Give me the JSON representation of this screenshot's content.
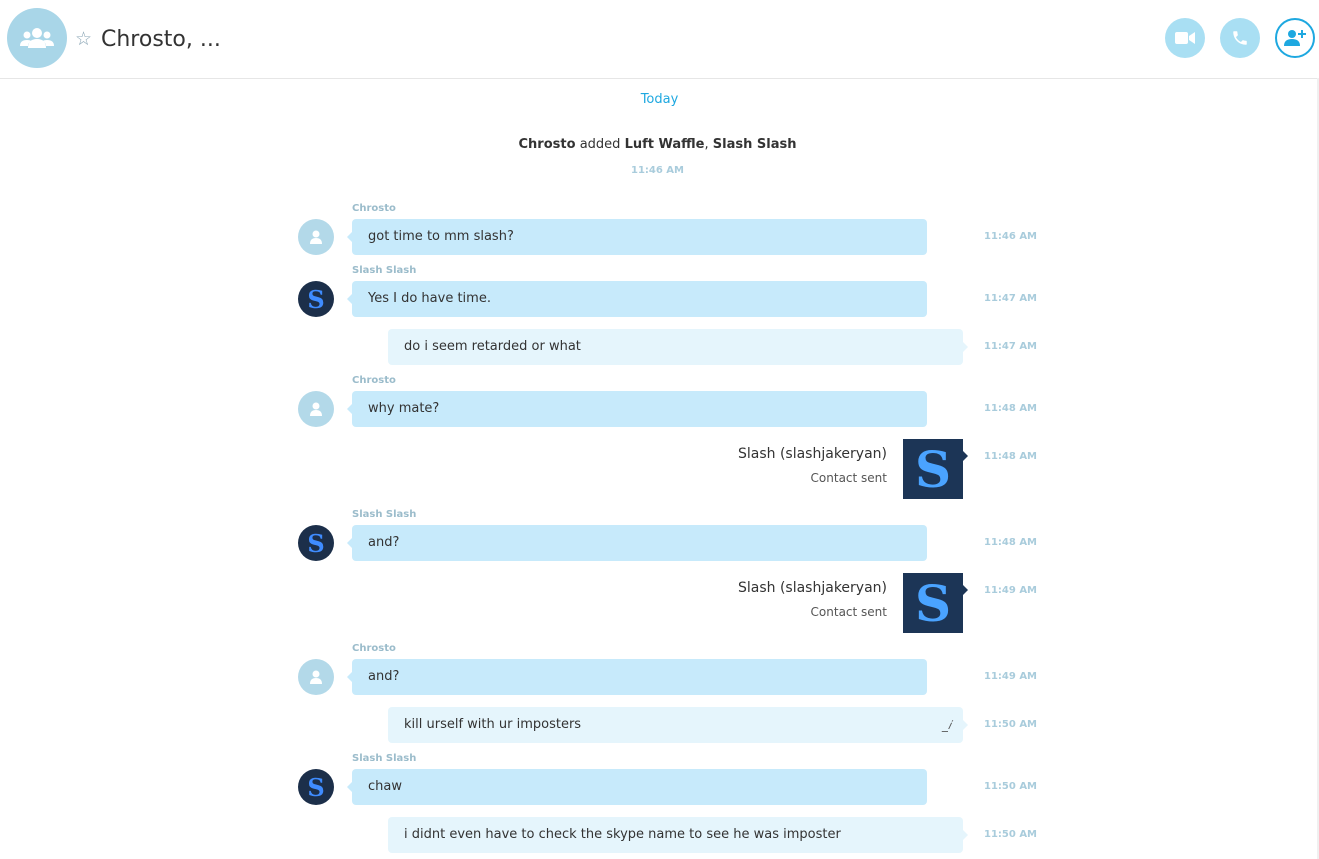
{
  "header": {
    "title": "Chrosto, ...",
    "favorite_icon": "star-outline-icon",
    "buttons": [
      "video-call-icon",
      "audio-call-icon",
      "add-people-icon"
    ]
  },
  "conversation": {
    "date_divider": "Today",
    "system": {
      "actor": "Chrosto",
      "verb": "added",
      "target1": "Luft Waffle",
      "separator": ",",
      "target2": "Slash Slash",
      "time": "11:46 AM"
    },
    "messages": [
      {
        "sender": "Chrosto",
        "text": "got time to mm slash?",
        "time": "11:46 AM"
      },
      {
        "sender": "Slash Slash",
        "text": "Yes I do have time.",
        "time": "11:47 AM"
      },
      {
        "text": "do i seem retarded or what",
        "time": "11:47 AM"
      },
      {
        "sender": "Chrosto",
        "text": "why mate?",
        "time": "11:48 AM"
      },
      {
        "contact_name": "Slash (slashjakeryan)",
        "contact_status": "Contact sent",
        "time": "11:48 AM"
      },
      {
        "sender": "Slash Slash",
        "text": "and?",
        "time": "11:48 AM"
      },
      {
        "contact_name": "Slash (slashjakeryan)",
        "contact_status": "Contact sent",
        "time": "11:49 AM"
      },
      {
        "sender": "Chrosto",
        "text": "and?",
        "time": "11:49 AM"
      },
      {
        "text": "kill urself with ur imposters",
        "time": "11:50 AM",
        "edited_icon": "edit-pencil-icon"
      },
      {
        "sender": "Slash Slash",
        "text": "chaw",
        "time": "11:50 AM"
      },
      {
        "text": "i didnt even have to check the skype name to see he was imposter",
        "time": "11:50 AM"
      }
    ]
  },
  "colors": {
    "accent": "#1ea8e0",
    "incoming_bubble": "#c7eafb",
    "outgoing_bubble": "#e5f5fc",
    "timestamp": "#a9ccdc"
  }
}
